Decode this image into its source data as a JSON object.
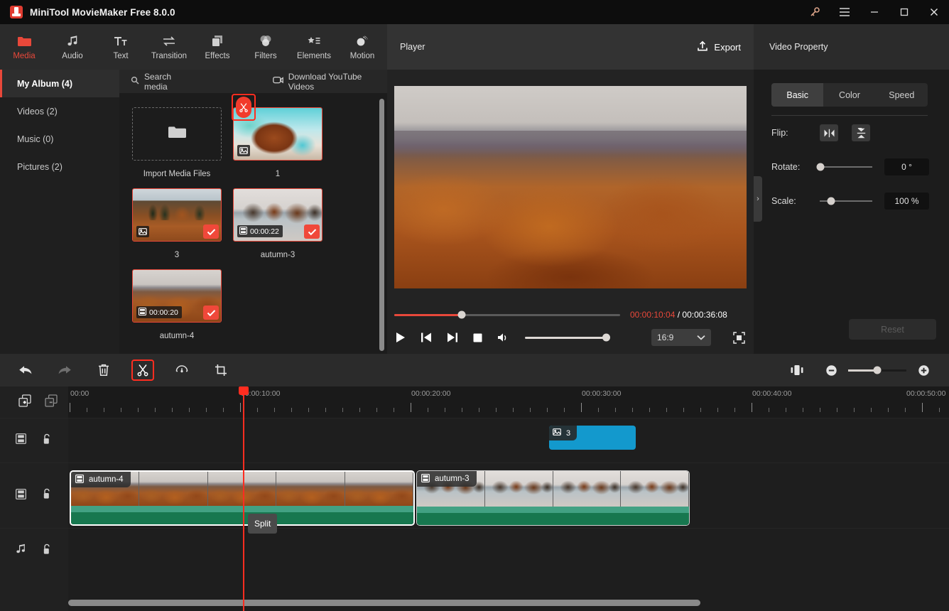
{
  "window": {
    "title": "MiniTool MovieMaker Free 8.0.0",
    "buttons": [
      {
        "name": "key-icon",
        "glyph": "key"
      },
      {
        "name": "menu-icon",
        "glyph": "hamburger"
      },
      {
        "name": "minimize-button",
        "glyph": "minimize"
      },
      {
        "name": "maximize-button",
        "glyph": "maximize"
      },
      {
        "name": "close-button",
        "glyph": "close"
      }
    ]
  },
  "tabs": [
    {
      "label": "Media",
      "icon": "folder-icon",
      "active": true
    },
    {
      "label": "Audio",
      "icon": "music-note-icon",
      "active": false
    },
    {
      "label": "Text",
      "icon": "text-icon",
      "active": false
    },
    {
      "label": "Transition",
      "icon": "transition-arrows-icon",
      "active": false
    },
    {
      "label": "Effects",
      "icon": "layers-icon",
      "active": false
    },
    {
      "label": "Filters",
      "icon": "filters-circles-icon",
      "active": false
    },
    {
      "label": "Elements",
      "icon": "star-list-icon",
      "active": false
    },
    {
      "label": "Motion",
      "icon": "motion-ball-icon",
      "active": false
    }
  ],
  "media": {
    "albums": [
      {
        "label": "My Album (4)",
        "active": true
      },
      {
        "label": "Videos (2)",
        "active": false
      },
      {
        "label": "Music (0)",
        "active": false
      },
      {
        "label": "Pictures (2)",
        "active": false
      }
    ],
    "search_placeholder": "Search media",
    "download_label": "Download YouTube Videos",
    "import_label": "Import Media Files",
    "items": [
      {
        "caption": "1",
        "type": "image",
        "duration": "",
        "checked": false,
        "thumb": "img-leaf"
      },
      {
        "caption": "3",
        "type": "image",
        "duration": "",
        "checked": true,
        "thumb": "img-cabin"
      },
      {
        "caption": "autumn-3",
        "type": "video",
        "duration": "00:00:22",
        "checked": true,
        "thumb": "img-lake"
      },
      {
        "caption": "autumn-4",
        "type": "video",
        "duration": "00:00:20",
        "checked": true,
        "thumb": "img-mtn"
      }
    ]
  },
  "player": {
    "title": "Player",
    "export_label": "Export",
    "current_time": "00:00:10:04",
    "separator": " / ",
    "total_time": "00:00:36:08",
    "progress_percent": 30,
    "volume_percent": 100,
    "aspect_ratio": "16:9",
    "controls": [
      "play-button",
      "previous-frame-button",
      "next-frame-button",
      "stop-button",
      "volume-button"
    ]
  },
  "property": {
    "title": "Video Property",
    "tabs": [
      {
        "label": "Basic",
        "active": true
      },
      {
        "label": "Color",
        "active": false
      },
      {
        "label": "Speed",
        "active": false
      }
    ],
    "flip_label": "Flip:",
    "rotate_label": "Rotate:",
    "rotate_value": "0 °",
    "rotate_percent": 0,
    "scale_label": "Scale:",
    "scale_value": "100 %",
    "scale_percent": 22,
    "reset_label": "Reset",
    "collapse_glyph": "›"
  },
  "timeline_toolbar": {
    "buttons": [
      {
        "name": "undo-button",
        "enabled": true
      },
      {
        "name": "redo-button",
        "enabled": false
      },
      {
        "name": "delete-button",
        "enabled": true
      },
      {
        "name": "split-button",
        "enabled": true,
        "highlighted": true
      },
      {
        "name": "speed-button",
        "enabled": true
      },
      {
        "name": "crop-button",
        "enabled": true
      }
    ],
    "zoom_percent": 50
  },
  "timeline": {
    "ruler_labels": [
      "00:00",
      "00:00:10:00",
      "00:00:20:00",
      "00:00:30:00",
      "00:00:40:00",
      "00:00:50:00"
    ],
    "ruler_positions": [
      0,
      240,
      480,
      720,
      960,
      1200
    ],
    "track_headers": [
      {
        "name": "add-track-button",
        "icon": "add-track-icon"
      },
      {
        "name": "remove-track-button",
        "icon": "remove-track-icon"
      },
      {
        "name": "video-track-2",
        "icon": "film-icon",
        "lock": "unlock-icon"
      },
      {
        "name": "video-track-1",
        "icon": "film-icon",
        "lock": "unlock-icon"
      },
      {
        "name": "audio-track-1",
        "icon": "music-note-icon",
        "lock": "unlock-icon"
      }
    ],
    "pip_clip": {
      "label": "3",
      "type": "image"
    },
    "clips": [
      {
        "label": "autumn-4",
        "type": "video",
        "selected": true
      },
      {
        "label": "autumn-3",
        "type": "video",
        "selected": false
      }
    ],
    "split_tooltip": "Split",
    "playhead_time": "00:00:10:04"
  }
}
